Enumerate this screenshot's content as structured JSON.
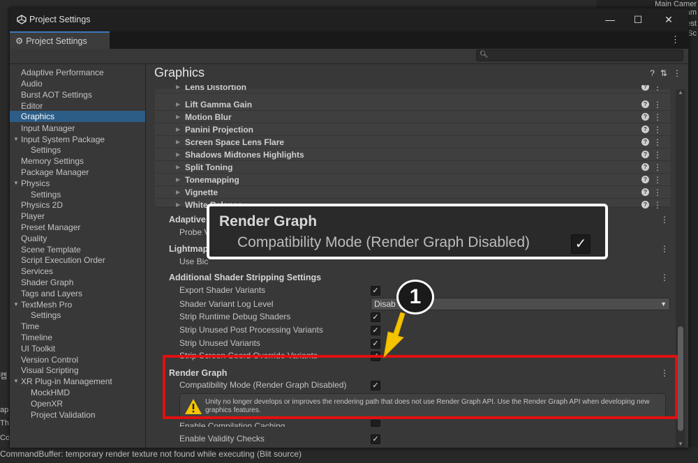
{
  "background": {
    "right_lines": [
      "Main Camer",
      "Cam",
      "est",
      "Sc"
    ],
    "left_lines": [
      "캡",
      "ap",
      "Th",
      "Co"
    ],
    "console_text": "CommandBuffer: temporary render texture  not found while executing  (Blit source)"
  },
  "window": {
    "title": "Project Settings",
    "controls": {
      "minimize": "—",
      "maximize": "☐",
      "close": "✕"
    },
    "tab_label": "Project Settings",
    "tab_menu": "⋮",
    "search": {
      "placeholder": "",
      "icon": "search-icon"
    }
  },
  "sidebar": {
    "items": [
      {
        "label": "Adaptive Performance"
      },
      {
        "label": "Audio"
      },
      {
        "label": "Burst AOT Settings"
      },
      {
        "label": "Editor"
      },
      {
        "label": "Graphics",
        "selected": true
      },
      {
        "label": "Input Manager"
      },
      {
        "label": "Input System Package",
        "expanded": true
      },
      {
        "label": "Settings",
        "child": true
      },
      {
        "label": "Memory Settings"
      },
      {
        "label": "Package Manager"
      },
      {
        "label": "Physics",
        "expanded": true
      },
      {
        "label": "Settings",
        "child": true
      },
      {
        "label": "Physics 2D"
      },
      {
        "label": "Player"
      },
      {
        "label": "Preset Manager"
      },
      {
        "label": "Quality"
      },
      {
        "label": "Scene Template"
      },
      {
        "label": "Script Execution Order"
      },
      {
        "label": "Services"
      },
      {
        "label": "Shader Graph"
      },
      {
        "label": "Tags and Layers"
      },
      {
        "label": "TextMesh Pro",
        "expanded": true
      },
      {
        "label": "Settings",
        "child": true
      },
      {
        "label": "Time"
      },
      {
        "label": "Timeline"
      },
      {
        "label": "UI Toolkit"
      },
      {
        "label": "Version Control"
      },
      {
        "label": "Visual Scripting"
      },
      {
        "label": "XR Plug-in Management",
        "expanded": true
      },
      {
        "label": "MockHMD",
        "child": true
      },
      {
        "label": "OpenXR",
        "child": true
      },
      {
        "label": "Project Validation",
        "child": true
      }
    ]
  },
  "content": {
    "title": "Graphics",
    "header_icons": [
      "?",
      "⇅",
      "⋮"
    ],
    "post_effects": [
      "Lens Distortion",
      "Lift Gamma Gain",
      "Motion Blur",
      "Panini Projection",
      "Screen Space Lens Flare",
      "Shadows Midtones Highlights",
      "Split Toning",
      "Tonemapping",
      "Vignette",
      "White Balance"
    ],
    "adaptive": {
      "title": "Adaptive",
      "sub": "Probe V"
    },
    "lightmap": {
      "title": "Lightmap",
      "sub": "Use Bic"
    },
    "stripping": {
      "title": "Additional Shader Stripping Settings",
      "rows": [
        {
          "label": "Export Shader Variants",
          "checked": true
        },
        {
          "label": "Shader Variant Log Level",
          "dropdown": "Disab"
        },
        {
          "label": "Strip Runtime Debug Shaders",
          "checked": true
        },
        {
          "label": "Strip Unused Post Processing Variants",
          "checked": true
        },
        {
          "label": "Strip Unused Variants",
          "checked": true
        },
        {
          "label": "Strip Screen Coord Override Variants",
          "checked": true
        }
      ]
    },
    "render_graph": {
      "title": "Render Graph",
      "compat_label": "Compatibility Mode (Render Graph Disabled)",
      "compat_checked": true,
      "warning": "Unity no longer develops or improves the rendering path that does not use Render Graph API. Use the Render Graph API when developing new graphics features.",
      "compilation_label": "Enable Compilation Caching",
      "validity_label": "Enable Validity Checks"
    }
  },
  "annotations": {
    "callout_title": "Render Graph",
    "callout_label": "Compatibility Mode (Render Graph Disabled)",
    "badge": "1",
    "colors": {
      "highlight_red": "#e01010",
      "arrow_yellow": "#f5c400",
      "callout_border": "#ffffff"
    }
  }
}
